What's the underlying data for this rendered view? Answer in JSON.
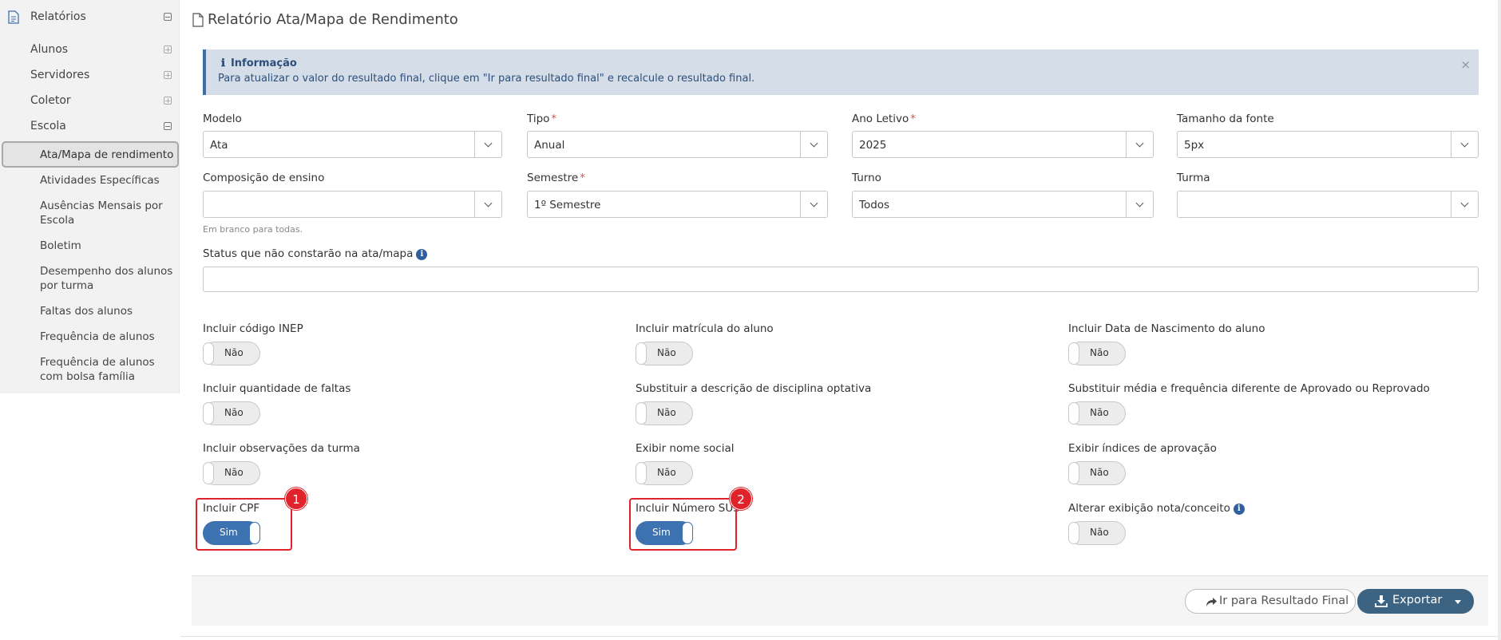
{
  "sidebar": {
    "section": "Relatórios",
    "items": [
      {
        "label": "Alunos"
      },
      {
        "label": "Servidores"
      },
      {
        "label": "Coletor"
      },
      {
        "label": "Escola"
      }
    ],
    "sub_items": [
      {
        "label": "Ata/Mapa de rendimento"
      },
      {
        "label": "Atividades Específicas"
      },
      {
        "label": "Ausências Mensais por Escola"
      },
      {
        "label": "Boletim"
      },
      {
        "label": "Desempenho dos alunos por turma"
      },
      {
        "label": "Faltas dos alunos"
      },
      {
        "label": "Frequência de alunos"
      },
      {
        "label": "Frequência de alunos com bolsa família"
      }
    ]
  },
  "page": {
    "title": "Relatório Ata/Mapa de Rendimento"
  },
  "info": {
    "title": "Informação",
    "text": "Para atualizar o valor do resultado final, clique em \"Ir para resultado final\" e recalcule o resultado final.",
    "close": "×"
  },
  "form": {
    "modelo": {
      "label": "Modelo",
      "value": "Ata"
    },
    "tipo": {
      "label": "Tipo",
      "value": "Anual"
    },
    "ano_letivo": {
      "label": "Ano Letivo",
      "value": "2025"
    },
    "tamanho_fonte": {
      "label": "Tamanho da fonte",
      "value": "5px"
    },
    "composicao": {
      "label": "Composição de ensino",
      "value": "",
      "help": "Em branco para todas."
    },
    "semestre": {
      "label": "Semestre",
      "value": "1º Semestre"
    },
    "turno": {
      "label": "Turno",
      "value": "Todos"
    },
    "turma": {
      "label": "Turma",
      "value": ""
    },
    "status_label": "Status que não constarão na ata/mapa",
    "required_mark": "*",
    "info_glyph": "i"
  },
  "toggles": [
    {
      "label": "Incluir código INEP",
      "value": "Não"
    },
    {
      "label": "Incluir matrícula do aluno",
      "value": "Não"
    },
    {
      "label": "Incluir Data de Nascimento do aluno",
      "value": "Não"
    },
    {
      "label": "Incluir quantidade de faltas",
      "value": "Não"
    },
    {
      "label": "Substituir a descrição de disciplina optativa",
      "value": "Não"
    },
    {
      "label": "Substituir média e frequência diferente de Aprovado ou Reprovado",
      "value": "Não"
    },
    {
      "label": "Incluir observações da turma",
      "value": "Não"
    },
    {
      "label": "Exibir nome social",
      "value": "Não"
    },
    {
      "label": "Exibir índices de aprovação",
      "value": "Não"
    },
    {
      "label": "Incluir CPF",
      "value": "Sim"
    },
    {
      "label": "Incluir Número SUS",
      "value": "Sim"
    },
    {
      "label": "Alterar exibição nota/conceito",
      "value": "Não"
    }
  ],
  "annotations": {
    "badge1": "1",
    "badge2": "2",
    "color": "#e0232b"
  },
  "footer": {
    "result_button": "Ir para Resultado Final",
    "export_button": "Exportar"
  },
  "colors": {
    "primary": "#3d72b0",
    "export": "#3c6381",
    "info_bg": "#d4dde8"
  }
}
